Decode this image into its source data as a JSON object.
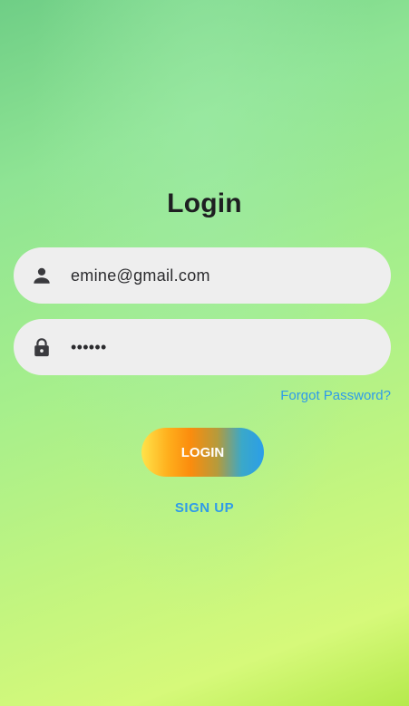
{
  "screen": {
    "title": "Login"
  },
  "form": {
    "email": {
      "value": "emine@gmail.com",
      "icon": "person-icon"
    },
    "password": {
      "value": "••••••",
      "icon": "lock-icon"
    },
    "forgot_label": "Forgot Password?",
    "login_label": "LOGIN",
    "signup_label": "SIGN UP"
  },
  "colors": {
    "link": "#2f9be9",
    "field_bg": "#eeeeee",
    "title": "#1e1f21",
    "button_gradient_start": "#ffe34a",
    "button_gradient_mid": "#fb8c0d",
    "button_gradient_end": "#2b9ee8"
  }
}
